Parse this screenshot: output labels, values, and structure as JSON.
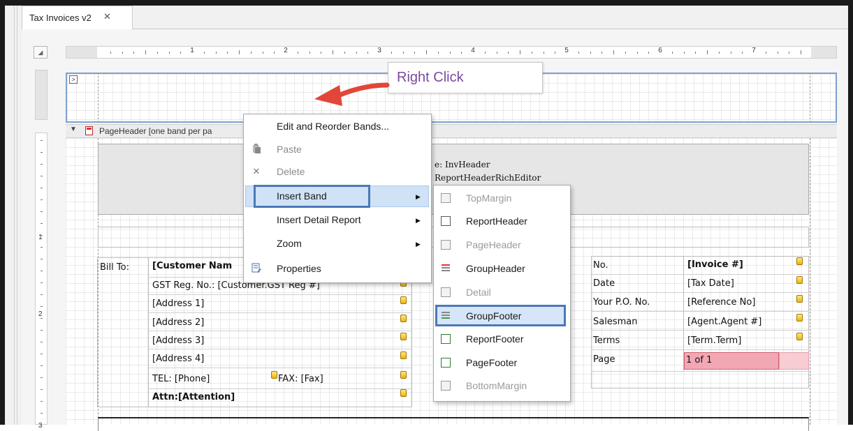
{
  "tab": {
    "title": "Tax Invoices v2",
    "close_glyph": "✕"
  },
  "ruler": {
    "h_numbers": [
      "1",
      "2",
      "3",
      "4",
      "5",
      "6",
      "7"
    ],
    "v_numbers": [
      "1",
      "2",
      "3"
    ]
  },
  "band_header": {
    "label": "PageHeader [one band per pa"
  },
  "rich_editor": {
    "line1": "e: InvHeader",
    "line2": "ReportHeaderRichEditor"
  },
  "callout": {
    "text": "Right Click",
    "arrow_color": "#e0473a"
  },
  "context_menu": {
    "items": [
      {
        "label": "Edit and Reorder Bands...",
        "icon": "",
        "disabled": false
      },
      {
        "label": "Paste",
        "icon": "paste-icon",
        "disabled": true
      },
      {
        "label": "Delete",
        "icon": "delete-icon",
        "disabled": true
      },
      {
        "label": "Insert Band",
        "icon": "",
        "disabled": false,
        "submenu": true,
        "highlighted": true
      },
      {
        "label": "Insert Detail Report",
        "icon": "",
        "disabled": false,
        "submenu": true
      },
      {
        "label": "Zoom",
        "icon": "",
        "disabled": false,
        "submenu": true
      },
      {
        "label": "Properties",
        "icon": "properties-icon",
        "disabled": false
      }
    ]
  },
  "band_submenu": {
    "items": [
      {
        "label": "TopMargin",
        "icon": "top-margin-band-icon",
        "disabled": true
      },
      {
        "label": "ReportHeader",
        "icon": "report-header-band-icon",
        "disabled": false
      },
      {
        "label": "PageHeader",
        "icon": "page-header-band-icon",
        "disabled": true
      },
      {
        "label": "GroupHeader",
        "icon": "group-header-band-icon",
        "disabled": false
      },
      {
        "label": "Detail",
        "icon": "detail-band-icon",
        "disabled": true
      },
      {
        "label": "GroupFooter",
        "icon": "group-footer-band-icon",
        "disabled": false,
        "highlighted": true
      },
      {
        "label": "ReportFooter",
        "icon": "report-footer-band-icon",
        "disabled": false
      },
      {
        "label": "PageFooter",
        "icon": "page-footer-band-icon",
        "disabled": false
      },
      {
        "label": "BottomMargin",
        "icon": "bottom-margin-band-icon",
        "disabled": true
      }
    ]
  },
  "bill_to": {
    "label": "Bill To:",
    "customer_name": "[Customer Nam",
    "gst": "GST Reg. No.: [Customer.GST Reg #]",
    "address1": "[Address 1]",
    "address2": "[Address 2]",
    "address3": "[Address 3]",
    "address4": "[Address 4]",
    "tel": "TEL: [Phone]",
    "fax": "FAX: [Fax]",
    "attn": "Attn:[Attention]"
  },
  "invoice_info": {
    "rows": [
      {
        "label": "No.",
        "value": "[Invoice #]"
      },
      {
        "label": "Date",
        "value": "[Tax Date]"
      },
      {
        "label": "Your P.O. No.",
        "value": "[Reference No]"
      },
      {
        "label": "Salesman",
        "value": "[Agent.Agent #]"
      },
      {
        "label": "Terms",
        "value": "[Term.Term]"
      },
      {
        "label": "Page",
        "value": "1 of 1"
      }
    ]
  }
}
